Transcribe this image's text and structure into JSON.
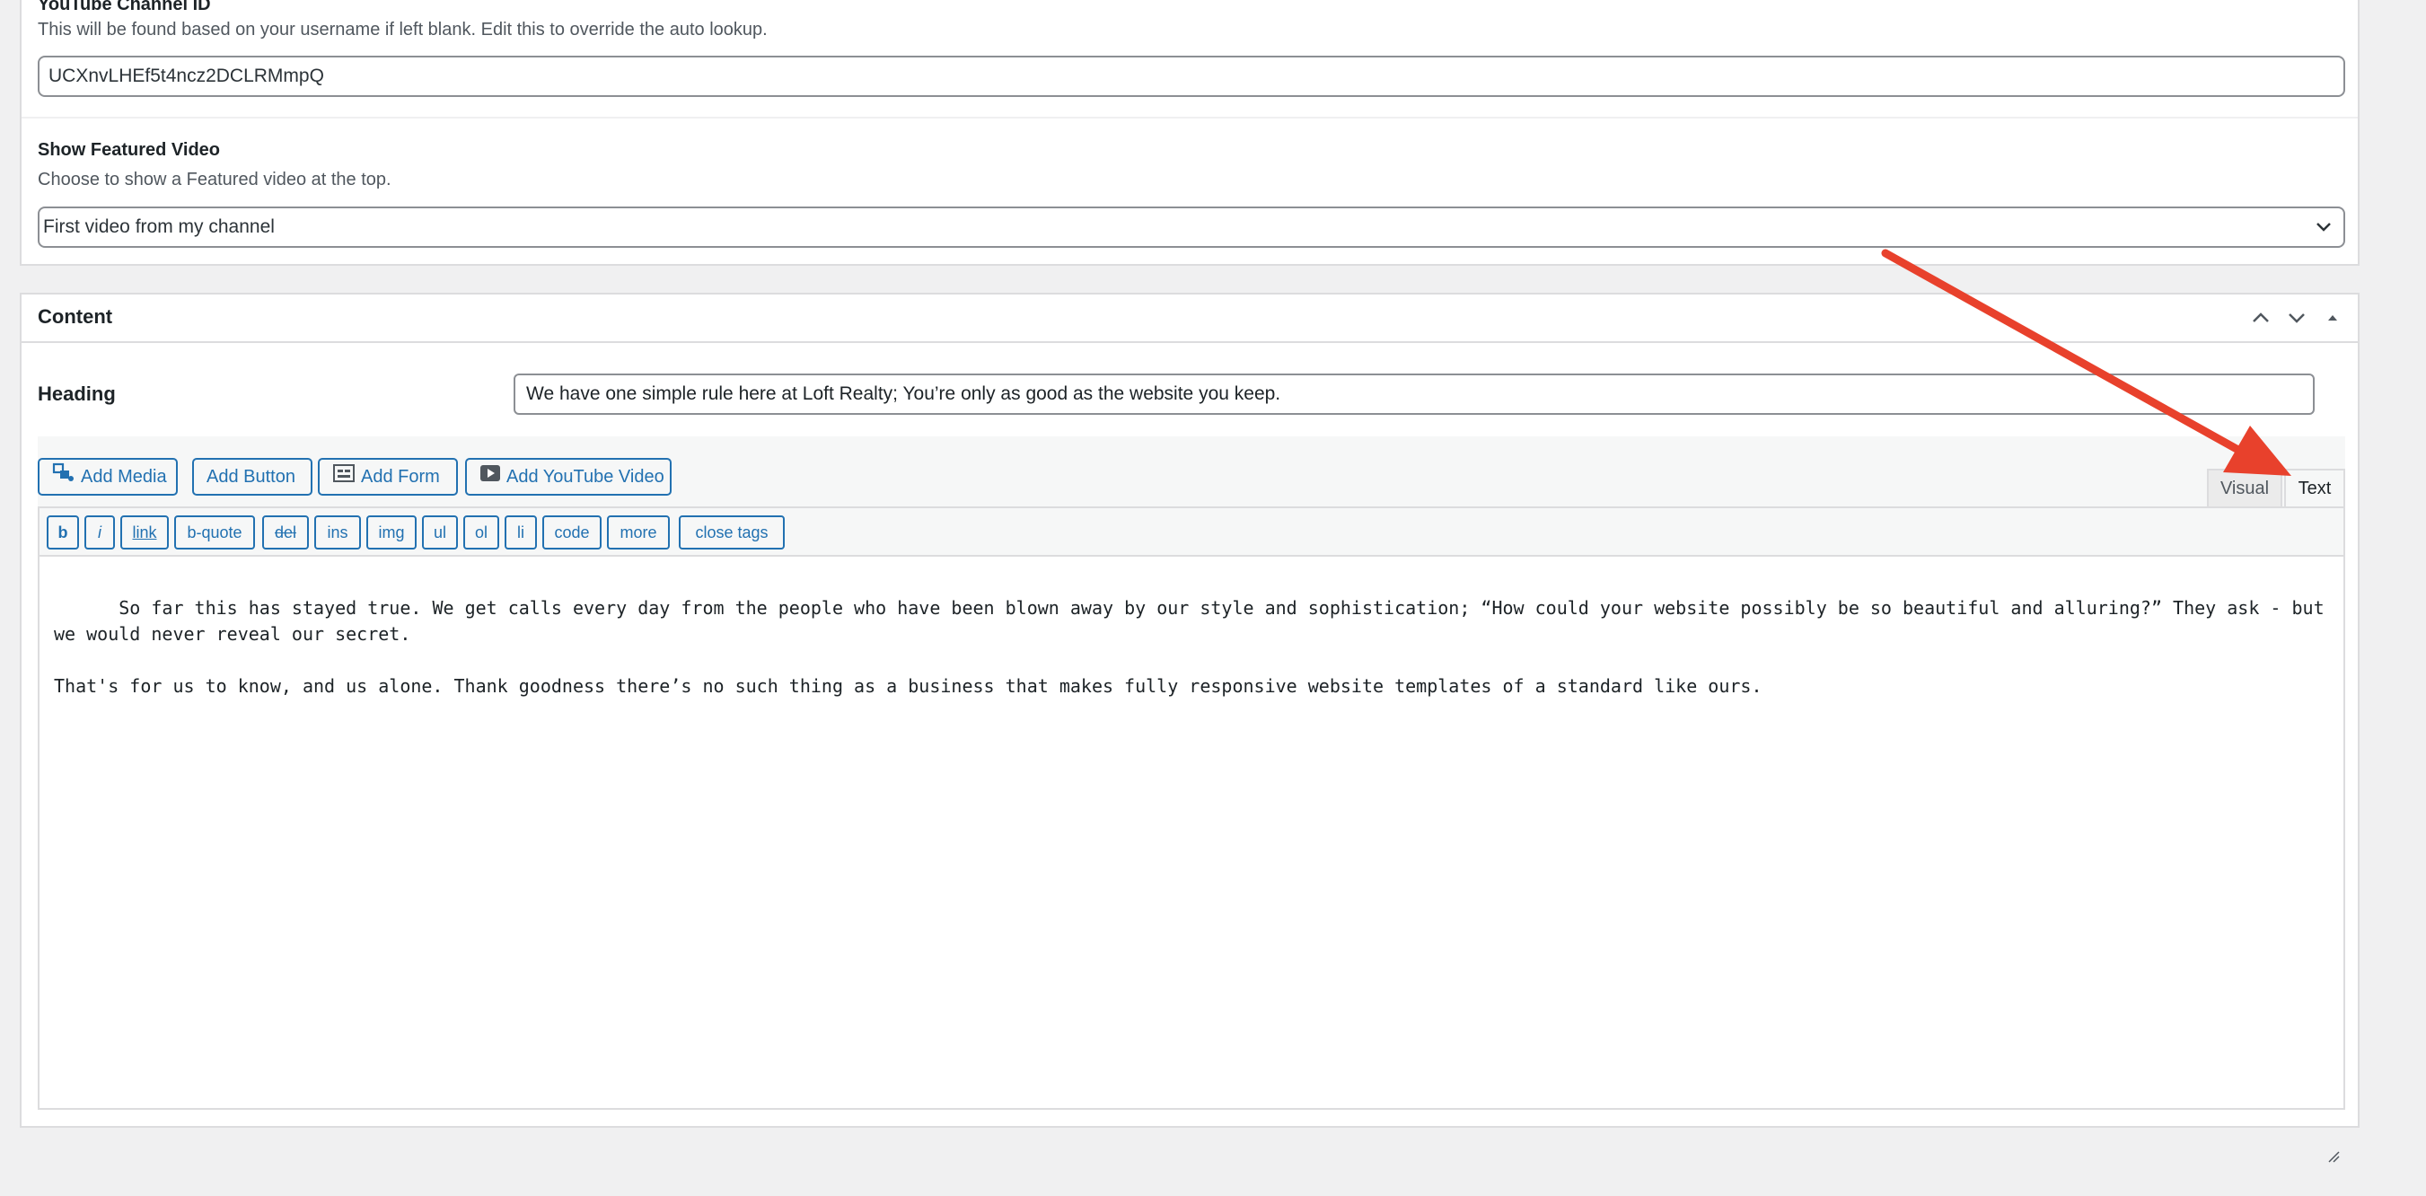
{
  "channel_section": {
    "label": "YouTube Channel ID",
    "description": "This will be found based on your username if left blank. Edit this to override the auto lookup.",
    "value": "UCXnvLHEf5t4ncz2DCLRMmpQ"
  },
  "featured_section": {
    "label": "Show Featured Video",
    "description": "Choose to show a Featured video at the top.",
    "selected": "First video from my channel"
  },
  "content_panel": {
    "title": "Content",
    "heading_label": "Heading",
    "heading_value": "We have one simple rule here at Loft Realty; You’re only as good as the website you keep."
  },
  "media_buttons": {
    "add_media": "Add Media",
    "add_button": "Add Button",
    "add_form": "Add Form",
    "add_youtube": "Add YouTube Video"
  },
  "editor_tabs": {
    "visual": "Visual",
    "text": "Text",
    "active": "text"
  },
  "quicktags": {
    "b": "b",
    "i": "i",
    "link": "link",
    "bquote": "b-quote",
    "del": "del",
    "ins": "ins",
    "img": "img",
    "ul": "ul",
    "ol": "ol",
    "li": "li",
    "code": "code",
    "more": "more",
    "close": "close tags"
  },
  "editor_content": "So far this has stayed true. We get calls every day from the people who have been blown away by our style and sophistication; “How could your website possibly be so beautiful and alluring?” They ask - but we would never reveal our secret.\n\nThat's for us to know, and us alone. Thank goodness there’s no such thing as a business that makes fully responsive website templates of a standard like ours.",
  "colors": {
    "accent": "#2271b1",
    "annotation_arrow": "#e8412c"
  }
}
